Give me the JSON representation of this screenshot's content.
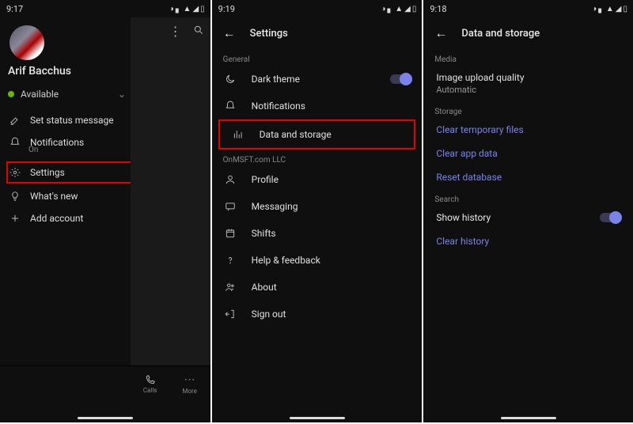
{
  "screen1": {
    "time": "9:17",
    "user_name": "Arif Bacchus",
    "presence": "Available",
    "menu": {
      "set_status": "Set status message",
      "notifications": "Notifications",
      "notifications_sub": "On",
      "settings": "Settings",
      "whats_new": "What's new",
      "add_account": "Add account"
    },
    "bottom": {
      "calls": "Calls",
      "more": "More"
    }
  },
  "screen2": {
    "time": "9:19",
    "title": "Settings",
    "section_general": "General",
    "dark_theme": "Dark theme",
    "notifications": "Notifications",
    "data_storage": "Data and storage",
    "section_org": "OnMSFT.com LLC",
    "profile": "Profile",
    "messaging": "Messaging",
    "shifts": "Shifts",
    "help": "Help & feedback",
    "about": "About",
    "sign_out": "Sign out"
  },
  "screen3": {
    "time": "9:18",
    "title": "Data and storage",
    "section_media": "Media",
    "upload_q": "Image upload quality",
    "upload_q_sub": "Automatic",
    "section_storage": "Storage",
    "clear_temp": "Clear temporary files",
    "clear_app": "Clear app data",
    "reset_db": "Reset database",
    "section_search": "Search",
    "show_history": "Show history",
    "clear_history": "Clear history"
  }
}
